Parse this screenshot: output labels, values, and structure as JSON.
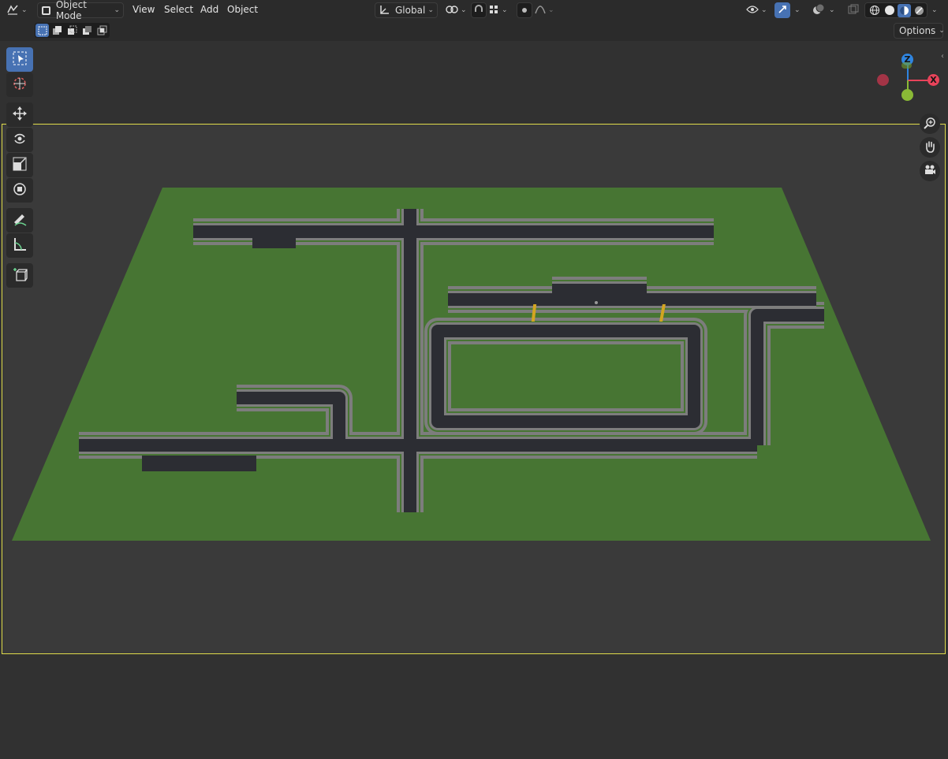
{
  "header": {
    "mode": "Object Mode",
    "menus": [
      "View",
      "Select",
      "Add",
      "Object"
    ],
    "transform_orientation": "Global"
  },
  "subheader": {
    "options_label": "Options"
  },
  "gizmo": {
    "z": "Z",
    "x": "X",
    "colors": {
      "x": "#e8435a",
      "y": "#8ab936",
      "z": "#2f85e0"
    }
  },
  "scene": {
    "colors": {
      "ground": "#477533",
      "road": "#2c2d33",
      "curb": "#7d7d7d",
      "lane_marking": "#d3a521",
      "camera_frame": "#e0dc4a"
    }
  }
}
